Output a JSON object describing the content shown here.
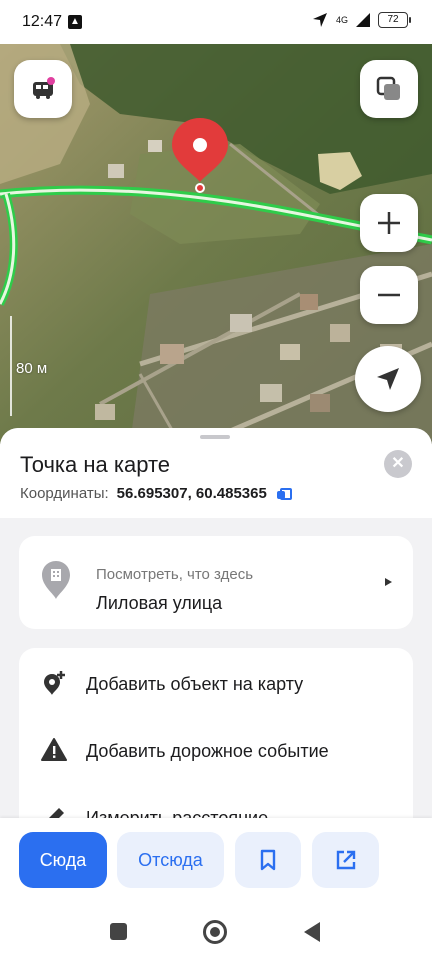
{
  "status_bar": {
    "time": "12:47",
    "network": "4G",
    "battery": "72"
  },
  "map": {
    "scale_label": "80 м",
    "zoom_in_label": "+",
    "zoom_out_label": "−"
  },
  "sheet": {
    "title": "Точка на карте",
    "coords_label": "Координаты:",
    "coords_value": "56.695307, 60.485365",
    "close_label": "✕"
  },
  "whats_here": {
    "subtitle": "Посмотреть, что здесь",
    "title": "Лиловая улица"
  },
  "actions": [
    {
      "label": "Добавить объект на карту",
      "icon": "add-place-icon"
    },
    {
      "label": "Добавить дорожное событие",
      "icon": "warning-icon"
    },
    {
      "label": "Измерить расстояние",
      "icon": "ruler-icon"
    }
  ],
  "action_bar": {
    "here_label": "Сюда",
    "from_label": "Отсюда"
  },
  "colors": {
    "accent": "#2b6ff0",
    "pin": "#e23b3b"
  }
}
